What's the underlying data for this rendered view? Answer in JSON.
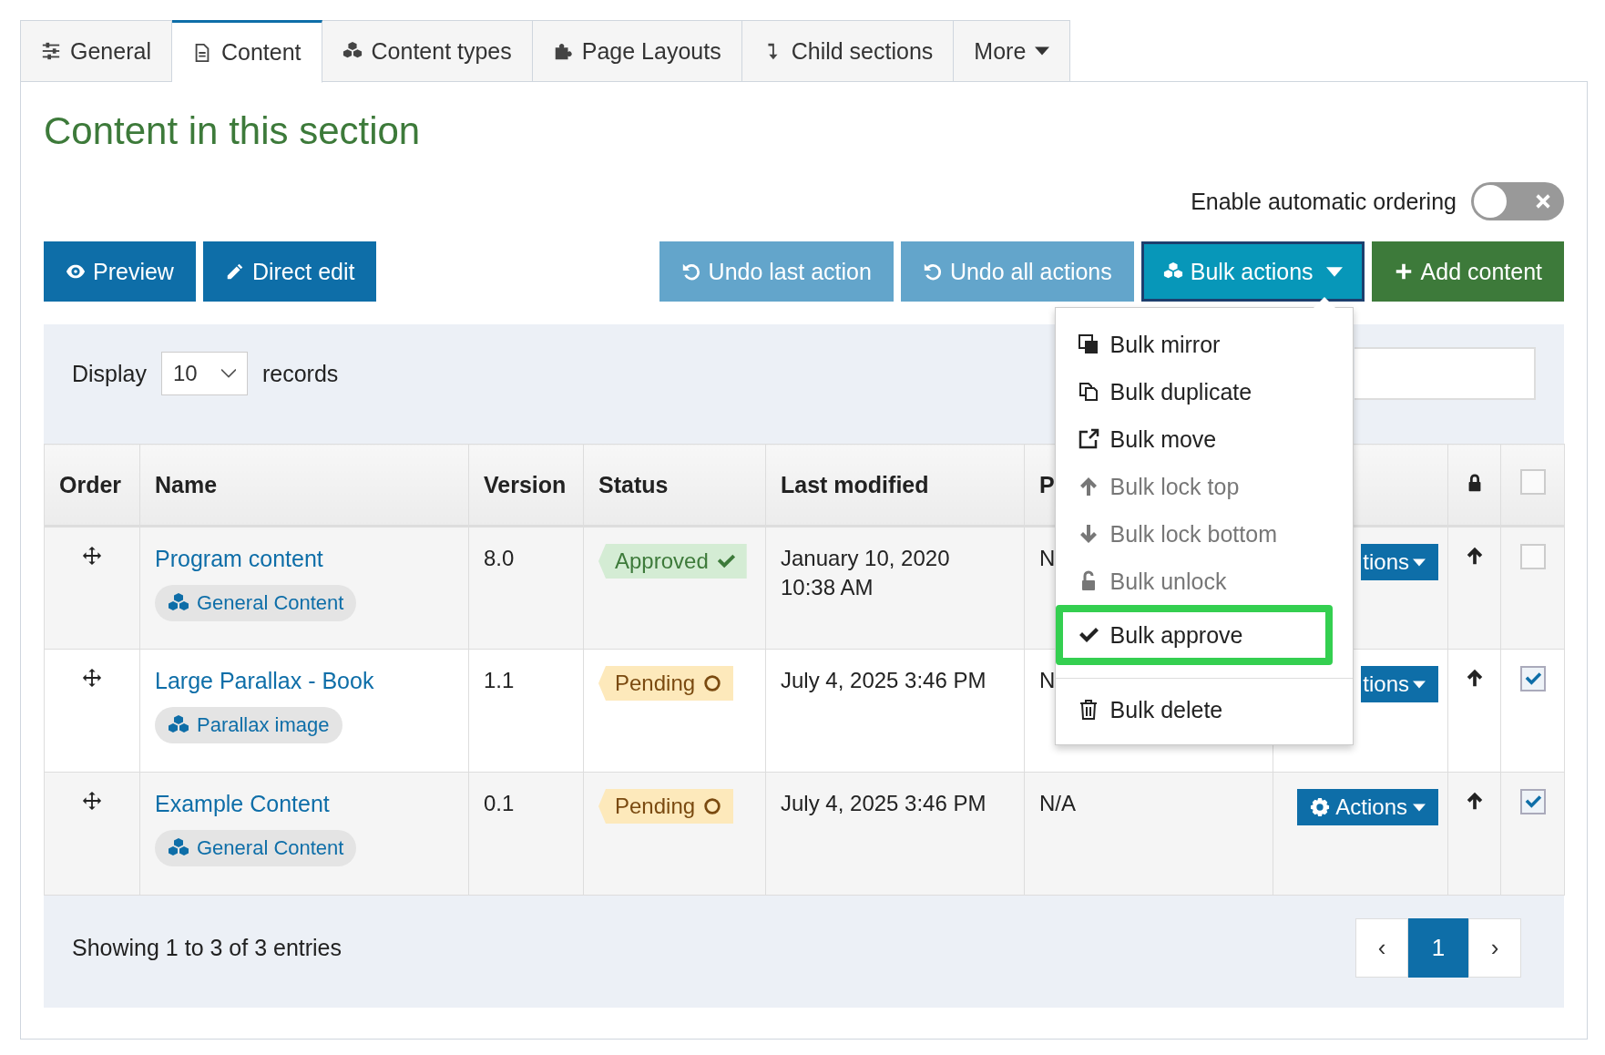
{
  "tabs": [
    {
      "label": "General",
      "selected": false
    },
    {
      "label": "Content",
      "selected": true
    },
    {
      "label": "Content types",
      "selected": false
    },
    {
      "label": "Page Layouts",
      "selected": false
    },
    {
      "label": "Child sections",
      "selected": false
    },
    {
      "label": "More",
      "selected": false
    }
  ],
  "heading": "Content in this section",
  "auto_ordering": {
    "label": "Enable automatic ordering",
    "on": false
  },
  "toolbar_left": [
    {
      "label": "Preview",
      "kind": "primary"
    },
    {
      "label": "Direct edit",
      "kind": "primary"
    }
  ],
  "toolbar_right": [
    {
      "label": "Undo last action",
      "kind": "muted"
    },
    {
      "label": "Undo all actions",
      "kind": "muted"
    },
    {
      "label": "Bulk actions",
      "kind": "dropdown",
      "expanded": true
    },
    {
      "label": "Add content",
      "kind": "success"
    }
  ],
  "bulk_menu": [
    {
      "label": "Bulk mirror",
      "disabled": false,
      "highlighted": false,
      "divider_before": false
    },
    {
      "label": "Bulk duplicate",
      "disabled": false,
      "highlighted": false,
      "divider_before": false
    },
    {
      "label": "Bulk move",
      "disabled": false,
      "highlighted": false,
      "divider_before": false
    },
    {
      "label": "Bulk lock top",
      "disabled": true,
      "highlighted": false,
      "divider_before": false
    },
    {
      "label": "Bulk lock bottom",
      "disabled": true,
      "highlighted": false,
      "divider_before": false
    },
    {
      "label": "Bulk unlock",
      "disabled": true,
      "highlighted": false,
      "divider_before": false
    },
    {
      "label": "Bulk approve",
      "disabled": false,
      "highlighted": true,
      "divider_before": false
    },
    {
      "label": "Bulk delete",
      "disabled": false,
      "highlighted": false,
      "divider_before": true
    }
  ],
  "display": {
    "label_before": "Display",
    "value": "10",
    "label_after": "records"
  },
  "table": {
    "columns": [
      "Order",
      "Name",
      "Version",
      "Status",
      "Last modified",
      "P"
    ],
    "header_checkbox": {
      "checked": false
    },
    "rows": [
      {
        "name": "Program content",
        "type": "General Content",
        "version": "8.0",
        "status": {
          "kind": "approved",
          "label": "Approved"
        },
        "modified": "January 10, 2020 10:38 AM",
        "publish": "N",
        "actions": {
          "label": "tions",
          "kind": "cut"
        },
        "checked": false
      },
      {
        "name": "Large Parallax - Book",
        "type": "Parallax image",
        "version": "1.1",
        "status": {
          "kind": "pending",
          "label": "Pending"
        },
        "modified": "July 4, 2025 3:46 PM",
        "publish": "N",
        "actions": {
          "label": "tions",
          "kind": "cut"
        },
        "checked": true
      },
      {
        "name": "Example Content",
        "type": "General Content",
        "version": "0.1",
        "status": {
          "kind": "pending",
          "label": "Pending"
        },
        "modified": "July 4, 2025 3:46 PM",
        "publish": "N/A",
        "actions": {
          "label": "Actions",
          "kind": "full"
        },
        "checked": true
      }
    ]
  },
  "footer": {
    "summary": "Showing 1 to 3 of 3 entries",
    "pages": [
      {
        "label": "‹",
        "selected": false
      },
      {
        "label": "1",
        "selected": true
      },
      {
        "label": "›",
        "selected": false
      }
    ]
  }
}
